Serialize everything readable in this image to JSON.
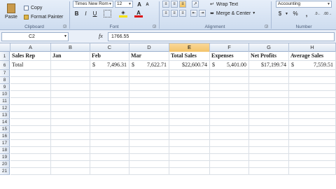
{
  "ribbon": {
    "clipboard": {
      "paste": "Paste",
      "copy": "Copy",
      "format_painter": "Format Painter",
      "label": "Clipboard"
    },
    "font": {
      "name": "Times New Rom",
      "size": "12",
      "label": "Font"
    },
    "alignment": {
      "wrap_text": "Wrap Text",
      "merge_center": "Merge & Center",
      "label": "Alignment"
    },
    "number": {
      "format": "Accounting",
      "dollar": "$",
      "percent": "%",
      "comma": ",",
      "label": "Number"
    }
  },
  "formula_bar": {
    "name_box": "C2",
    "fx": "fx",
    "value": "1766.55"
  },
  "columns": [
    "A",
    "B",
    "C",
    "D",
    "E",
    "F",
    "G",
    "H"
  ],
  "selected_column": "E",
  "rows": [
    "1",
    "6",
    "7",
    "8",
    "9",
    "10",
    "11",
    "12",
    "13",
    "14",
    "15",
    "16",
    "17",
    "18",
    "19",
    "20",
    "21"
  ],
  "headers": {
    "a": "Sales Rep",
    "b": "Jan",
    "c": "Feb",
    "d": "Mar",
    "e": "Total Sales",
    "f": "Expenses",
    "g": "Net Profits",
    "h": "Average Sales"
  },
  "total_row": {
    "label": "Total",
    "feb": "7,496.31",
    "mar": "7,622.71",
    "total_sales": "$22,600.74",
    "expenses": "5,401.00",
    "net_profits": "$17,199.74",
    "average_sales": "7,559.51",
    "currency": "$"
  }
}
